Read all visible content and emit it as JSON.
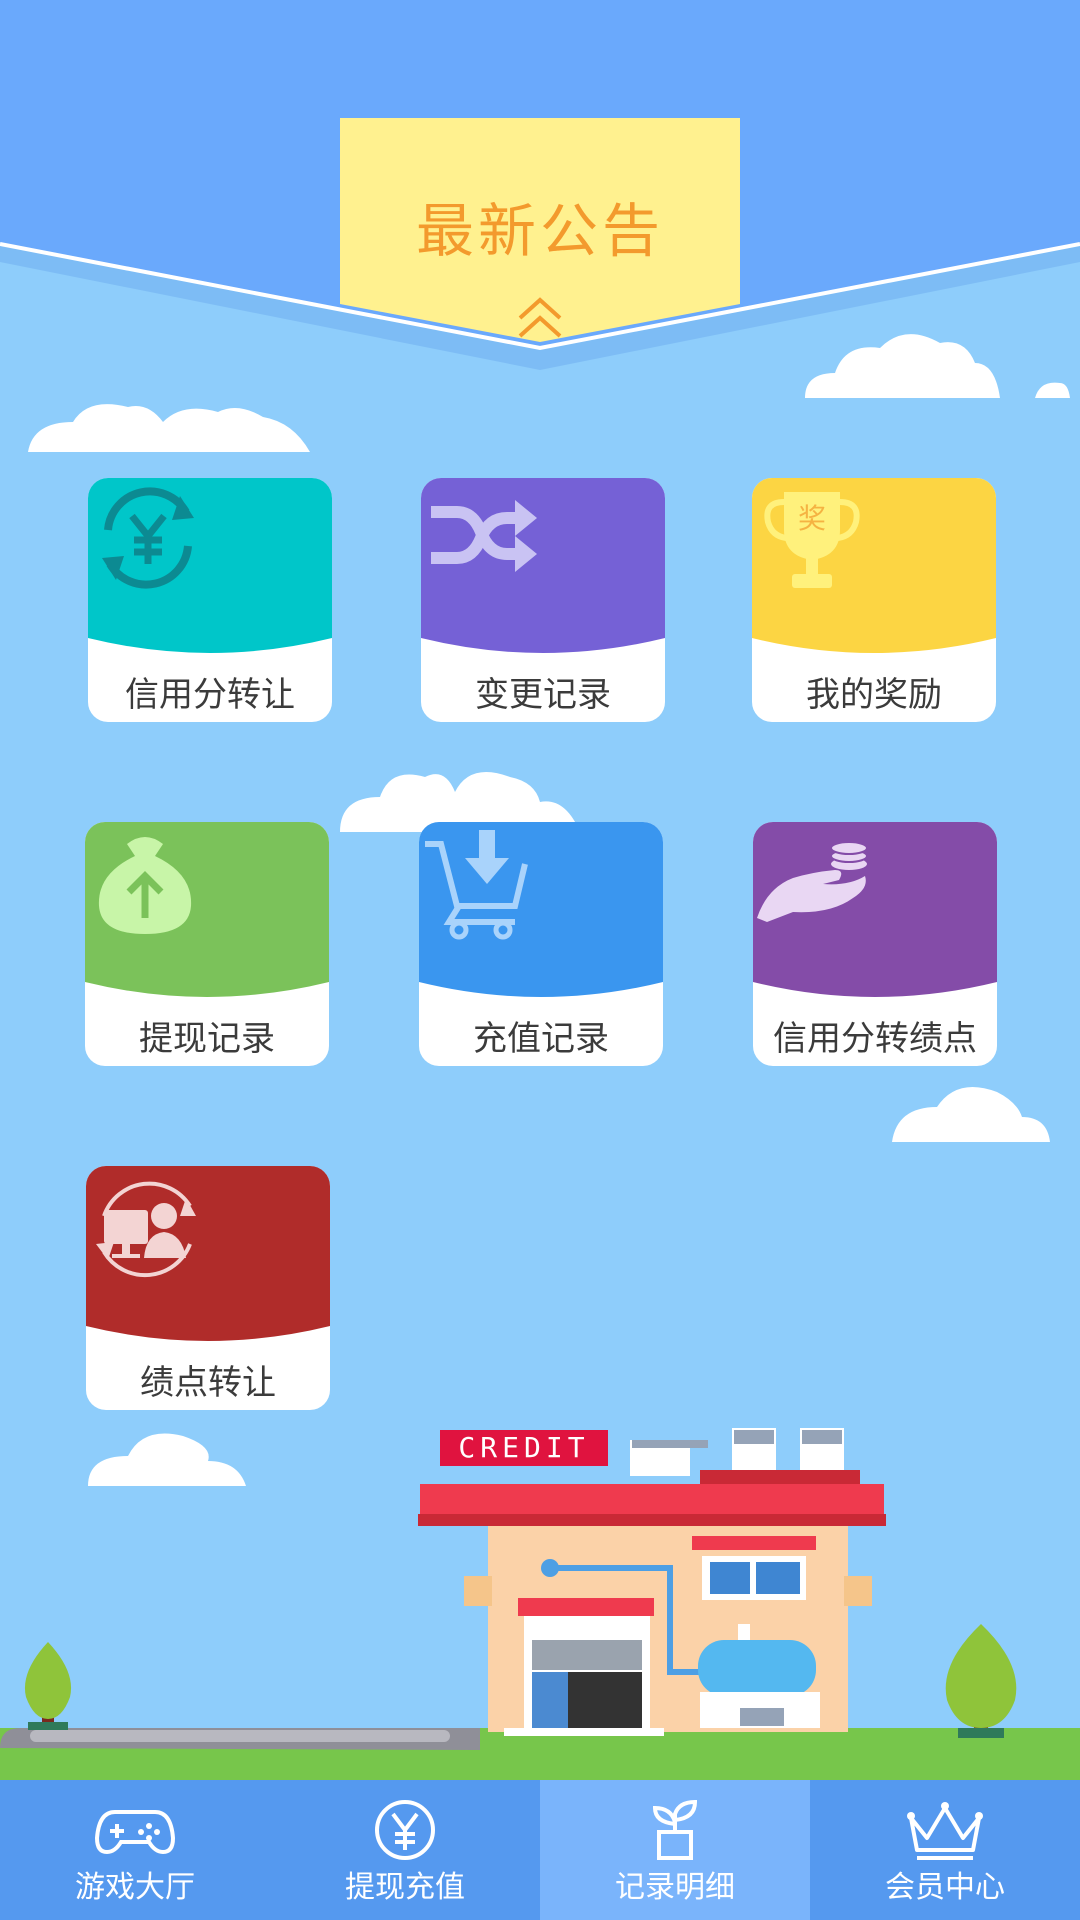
{
  "notice": {
    "title": "最新公告",
    "expand_icon": "double-chevron-up-icon"
  },
  "tiles": [
    {
      "label": "信用分转让",
      "icon": "yen-exchange-icon",
      "color": "#00c6c9"
    },
    {
      "label": "变更记录",
      "icon": "shuffle-icon",
      "color": "#7561d6"
    },
    {
      "label": "我的奖励",
      "icon": "trophy-icon",
      "icon_text": "奖",
      "color": "#fcd543"
    },
    {
      "label": "提现记录",
      "icon": "money-bag-up-icon",
      "color": "#7bc25a"
    },
    {
      "label": "充值记录",
      "icon": "cart-download-icon",
      "color": "#3a96ef"
    },
    {
      "label": "信用分转绩点",
      "icon": "hand-coins-icon",
      "color": "#844ca8"
    },
    {
      "label": "绩点转让",
      "icon": "computer-person-transfer-icon",
      "color": "#b02c2a"
    }
  ],
  "illustration": {
    "sign_text": "CREDIT"
  },
  "nav": {
    "active_index": 2,
    "items": [
      {
        "label": "游戏大厅",
        "icon": "gamepad-icon"
      },
      {
        "label": "提现充值",
        "icon": "yen-circle-icon"
      },
      {
        "label": "记录明细",
        "icon": "sprout-pot-icon"
      },
      {
        "label": "会员中心",
        "icon": "crown-icon"
      }
    ]
  },
  "colors": {
    "sky_top": "#6aa9fc",
    "sky": "#8ecdfb",
    "notice_bg": "#fff18f",
    "notice_text": "#f39a2d",
    "navbar": "#5599ef",
    "nav_active": "#7ab4fb",
    "grass": "#77c64b",
    "roof": "#ef3a4e"
  }
}
